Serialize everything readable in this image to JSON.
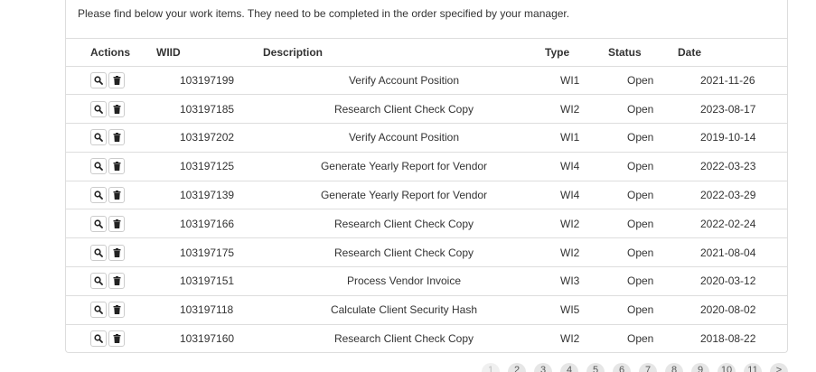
{
  "intro_text": "Please find below your work items. They need to be completed in the order specified by your manager.",
  "table": {
    "headers": {
      "actions": "Actions",
      "wiid": "WIID",
      "description": "Description",
      "type": "Type",
      "status": "Status",
      "date": "Date"
    },
    "rows": [
      {
        "wiid": "103197199",
        "description": "Verify Account Position",
        "type": "WI1",
        "status": "Open",
        "date": "2021-11-26"
      },
      {
        "wiid": "103197185",
        "description": "Research Client Check Copy",
        "type": "WI2",
        "status": "Open",
        "date": "2023-08-17"
      },
      {
        "wiid": "103197202",
        "description": "Verify Account Position",
        "type": "WI1",
        "status": "Open",
        "date": "2019-10-14"
      },
      {
        "wiid": "103197125",
        "description": "Generate Yearly Report for Vendor",
        "type": "WI4",
        "status": "Open",
        "date": "2022-03-23"
      },
      {
        "wiid": "103197139",
        "description": "Generate Yearly Report for Vendor",
        "type": "WI4",
        "status": "Open",
        "date": "2022-03-29"
      },
      {
        "wiid": "103197166",
        "description": "Research Client Check Copy",
        "type": "WI2",
        "status": "Open",
        "date": "2022-02-24"
      },
      {
        "wiid": "103197175",
        "description": "Research Client Check Copy",
        "type": "WI2",
        "status": "Open",
        "date": "2021-08-04"
      },
      {
        "wiid": "103197151",
        "description": "Process Vendor Invoice",
        "type": "WI3",
        "status": "Open",
        "date": "2020-03-12"
      },
      {
        "wiid": "103197118",
        "description": "Calculate Client Security Hash",
        "type": "WI5",
        "status": "Open",
        "date": "2020-08-02"
      },
      {
        "wiid": "103197160",
        "description": "Research Client Check Copy",
        "type": "WI2",
        "status": "Open",
        "date": "2018-08-22"
      }
    ],
    "row_icons": [
      "search-icon",
      "trash-icon"
    ]
  },
  "pagination": {
    "pages": [
      "1",
      "2",
      "3",
      "4",
      "5",
      "6",
      "7",
      "8",
      "9",
      "10",
      "11",
      ">"
    ],
    "active": "1"
  }
}
